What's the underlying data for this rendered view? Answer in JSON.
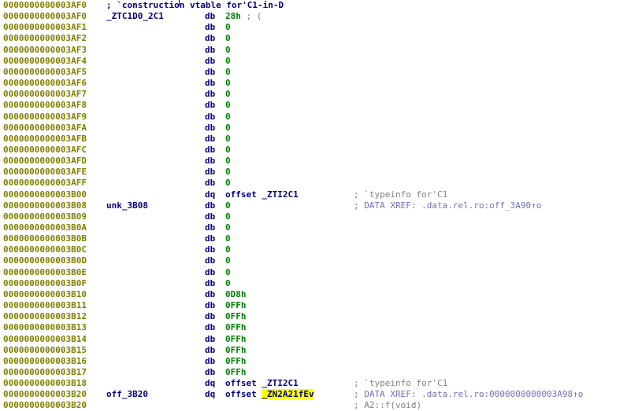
{
  "lines": [
    {
      "addr": "0000000000003AF0",
      "label": "",
      "mnem": "; `construction vtable for'C1-in-D",
      "op": "",
      "op_kind": "",
      "comment": "",
      "comment_kind": "",
      "full_comment": true
    },
    {
      "addr": "0000000000003AF0",
      "label": "_ZTC1D0_2C1",
      "mnem": "db",
      "op": "28h",
      "op_kind": "num",
      "op_tail": " ; (",
      "comment": "",
      "comment_kind": ""
    },
    {
      "addr": "0000000000003AF1",
      "label": "",
      "mnem": "db",
      "op": "0",
      "op_kind": "num",
      "comment": "",
      "comment_kind": ""
    },
    {
      "addr": "0000000000003AF2",
      "label": "",
      "mnem": "db",
      "op": "0",
      "op_kind": "num",
      "comment": "",
      "comment_kind": ""
    },
    {
      "addr": "0000000000003AF3",
      "label": "",
      "mnem": "db",
      "op": "0",
      "op_kind": "num",
      "comment": "",
      "comment_kind": ""
    },
    {
      "addr": "0000000000003AF4",
      "label": "",
      "mnem": "db",
      "op": "0",
      "op_kind": "num",
      "comment": "",
      "comment_kind": ""
    },
    {
      "addr": "0000000000003AF5",
      "label": "",
      "mnem": "db",
      "op": "0",
      "op_kind": "num",
      "comment": "",
      "comment_kind": ""
    },
    {
      "addr": "0000000000003AF6",
      "label": "",
      "mnem": "db",
      "op": "0",
      "op_kind": "num",
      "comment": "",
      "comment_kind": ""
    },
    {
      "addr": "0000000000003AF7",
      "label": "",
      "mnem": "db",
      "op": "0",
      "op_kind": "num",
      "comment": "",
      "comment_kind": ""
    },
    {
      "addr": "0000000000003AF8",
      "label": "",
      "mnem": "db",
      "op": "0",
      "op_kind": "num",
      "comment": "",
      "comment_kind": ""
    },
    {
      "addr": "0000000000003AF9",
      "label": "",
      "mnem": "db",
      "op": "0",
      "op_kind": "num",
      "comment": "",
      "comment_kind": ""
    },
    {
      "addr": "0000000000003AFA",
      "label": "",
      "mnem": "db",
      "op": "0",
      "op_kind": "num",
      "comment": "",
      "comment_kind": ""
    },
    {
      "addr": "0000000000003AFB",
      "label": "",
      "mnem": "db",
      "op": "0",
      "op_kind": "num",
      "comment": "",
      "comment_kind": ""
    },
    {
      "addr": "0000000000003AFC",
      "label": "",
      "mnem": "db",
      "op": "0",
      "op_kind": "num",
      "comment": "",
      "comment_kind": ""
    },
    {
      "addr": "0000000000003AFD",
      "label": "",
      "mnem": "db",
      "op": "0",
      "op_kind": "num",
      "comment": "",
      "comment_kind": ""
    },
    {
      "addr": "0000000000003AFE",
      "label": "",
      "mnem": "db",
      "op": "0",
      "op_kind": "num",
      "comment": "",
      "comment_kind": ""
    },
    {
      "addr": "0000000000003AFF",
      "label": "",
      "mnem": "db",
      "op": "0",
      "op_kind": "num",
      "comment": "",
      "comment_kind": ""
    },
    {
      "addr": "0000000000003B00",
      "label": "",
      "mnem": "dq",
      "op": "offset _ZTI2C1",
      "op_kind": "ref",
      "comment": "; `typeinfo for'C1",
      "comment_kind": "cmt"
    },
    {
      "addr": "0000000000003B08",
      "label": "unk_3B08",
      "mnem": "db",
      "op": "0",
      "op_kind": "num",
      "comment": "; DATA XREF: .data.rel.ro:off_3A90↑o",
      "comment_kind": "xref"
    },
    {
      "addr": "0000000000003B09",
      "label": "",
      "mnem": "db",
      "op": "0",
      "op_kind": "num",
      "comment": "",
      "comment_kind": ""
    },
    {
      "addr": "0000000000003B0A",
      "label": "",
      "mnem": "db",
      "op": "0",
      "op_kind": "num",
      "comment": "",
      "comment_kind": ""
    },
    {
      "addr": "0000000000003B0B",
      "label": "",
      "mnem": "db",
      "op": "0",
      "op_kind": "num",
      "comment": "",
      "comment_kind": ""
    },
    {
      "addr": "0000000000003B0C",
      "label": "",
      "mnem": "db",
      "op": "0",
      "op_kind": "num",
      "comment": "",
      "comment_kind": ""
    },
    {
      "addr": "0000000000003B0D",
      "label": "",
      "mnem": "db",
      "op": "0",
      "op_kind": "num",
      "comment": "",
      "comment_kind": ""
    },
    {
      "addr": "0000000000003B0E",
      "label": "",
      "mnem": "db",
      "op": "0",
      "op_kind": "num",
      "comment": "",
      "comment_kind": ""
    },
    {
      "addr": "0000000000003B0F",
      "label": "",
      "mnem": "db",
      "op": "0",
      "op_kind": "num",
      "comment": "",
      "comment_kind": ""
    },
    {
      "addr": "0000000000003B10",
      "label": "",
      "mnem": "db",
      "op": "0D8h",
      "op_kind": "num",
      "comment": "",
      "comment_kind": ""
    },
    {
      "addr": "0000000000003B11",
      "label": "",
      "mnem": "db",
      "op": "0FFh",
      "op_kind": "num",
      "comment": "",
      "comment_kind": ""
    },
    {
      "addr": "0000000000003B12",
      "label": "",
      "mnem": "db",
      "op": "0FFh",
      "op_kind": "num",
      "comment": "",
      "comment_kind": ""
    },
    {
      "addr": "0000000000003B13",
      "label": "",
      "mnem": "db",
      "op": "0FFh",
      "op_kind": "num",
      "comment": "",
      "comment_kind": ""
    },
    {
      "addr": "0000000000003B14",
      "label": "",
      "mnem": "db",
      "op": "0FFh",
      "op_kind": "num",
      "comment": "",
      "comment_kind": ""
    },
    {
      "addr": "0000000000003B15",
      "label": "",
      "mnem": "db",
      "op": "0FFh",
      "op_kind": "num",
      "comment": "",
      "comment_kind": ""
    },
    {
      "addr": "0000000000003B16",
      "label": "",
      "mnem": "db",
      "op": "0FFh",
      "op_kind": "num",
      "comment": "",
      "comment_kind": ""
    },
    {
      "addr": "0000000000003B17",
      "label": "",
      "mnem": "db",
      "op": "0FFh",
      "op_kind": "num",
      "comment": "",
      "comment_kind": ""
    },
    {
      "addr": "0000000000003B18",
      "label": "",
      "mnem": "dq",
      "op": "offset _ZTI2C1",
      "op_kind": "ref",
      "comment": "; `typeinfo for'C1",
      "comment_kind": "cmt"
    },
    {
      "addr": "0000000000003B20",
      "label": "off_3B20",
      "mnem": "dq",
      "op": "offset ",
      "op_kind": "ref",
      "op_hl": "_ZN2A21fEv",
      "comment": "; DATA XREF: .data.rel.ro:0000000000003A98↑o",
      "comment_kind": "xref"
    },
    {
      "addr": "0000000000003B20",
      "label": "",
      "mnem": "",
      "op": "",
      "op_kind": "",
      "comment": "; A2::f(void)",
      "comment_kind": "cmt"
    }
  ],
  "colors": {
    "address": "#808000",
    "name": "#000080",
    "number": "#008000",
    "comment": "#808080",
    "xref": "#7070c0",
    "highlight": "#ffff00"
  }
}
